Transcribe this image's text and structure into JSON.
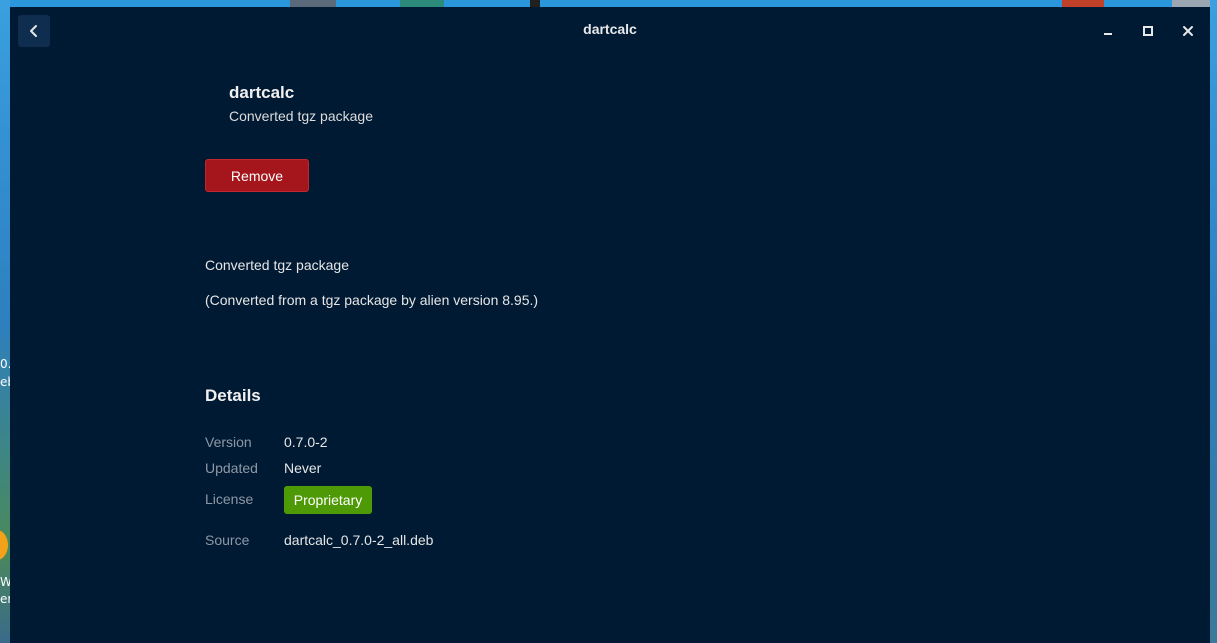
{
  "window": {
    "title": "dartcalc"
  },
  "app": {
    "name": "dartcalc",
    "summary": "Converted tgz package",
    "remove_label": "Remove"
  },
  "description": {
    "line1": "Converted tgz package",
    "line2": "(Converted from a tgz package by alien version 8.95.)"
  },
  "details": {
    "heading": "Details",
    "rows": [
      {
        "label": "Version",
        "value": "0.7.0-2"
      },
      {
        "label": "Updated",
        "value": "Never"
      },
      {
        "label": "License",
        "value": "Proprietary"
      },
      {
        "label": "Source",
        "value": "dartcalc_0.7.0-2_all.deb"
      }
    ]
  },
  "desktop": {
    "text_fragments": [
      "0.",
      "eb",
      "We",
      "er"
    ]
  },
  "colors": {
    "window_bg": "#001a33",
    "remove_button": "#a5161c",
    "license_badge": "#4e9a06",
    "label_text": "#8e98a4"
  },
  "icons": {
    "back": "chevron-left-icon",
    "minimize": "minimize-icon",
    "maximize": "maximize-icon",
    "close": "close-icon"
  }
}
